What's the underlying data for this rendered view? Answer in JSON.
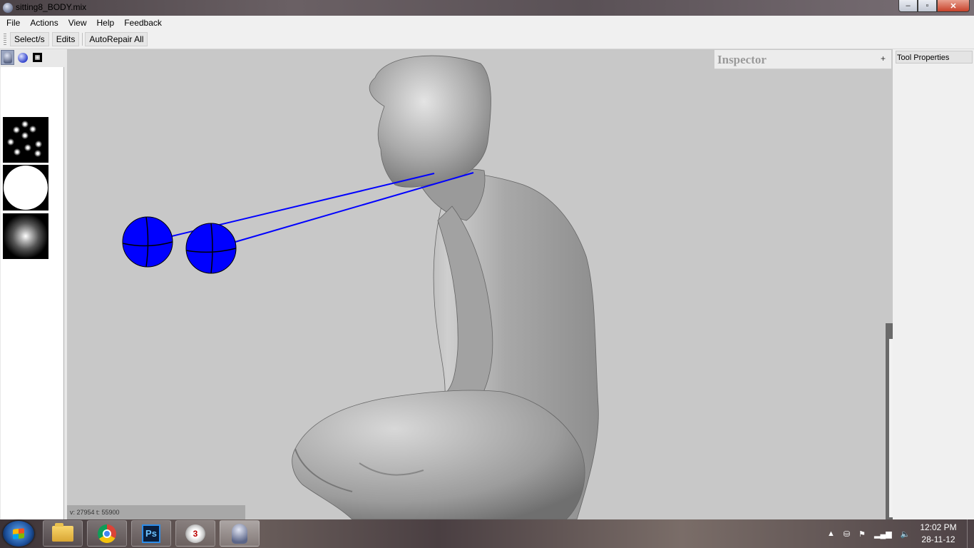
{
  "window": {
    "title": "sitting8_BODY.mix",
    "controls": {
      "minimize": "–",
      "maximize": "▫",
      "close": "✕"
    }
  },
  "menubar": {
    "items": [
      "File",
      "Actions",
      "View",
      "Help",
      "Feedback"
    ]
  },
  "toolbar": {
    "select_label": "Select/s",
    "edits_label": "Edits",
    "autorepair_label": "AutoRepair All"
  },
  "left_panel": {
    "tabs": [
      "bust-icon",
      "sphere-icon",
      "square-icon"
    ],
    "alpha_swatches": [
      "dots-stamp",
      "hard-circle",
      "soft-falloff"
    ]
  },
  "viewport": {
    "status": "v: 27954  t: 55900",
    "model_color": "#b0b0b0",
    "marker_color": "#0000ff"
  },
  "inspector": {
    "title": "Inspector",
    "expand": "+"
  },
  "tool_properties": {
    "title": "Tool Properties"
  },
  "taskbar": {
    "apps": [
      "folder-icon",
      "chrome-icon",
      "photoshop-icon",
      "app-icon",
      "meshmixer-icon"
    ],
    "photoshop_label": "Ps",
    "app3_label": "3",
    "clock_time": "12:02 PM",
    "clock_date": "28-11-12",
    "tray": {
      "expand": "▲",
      "usb": "⛁",
      "flag": "⚑",
      "network": "▂▄▆",
      "volume": "🔈"
    }
  }
}
